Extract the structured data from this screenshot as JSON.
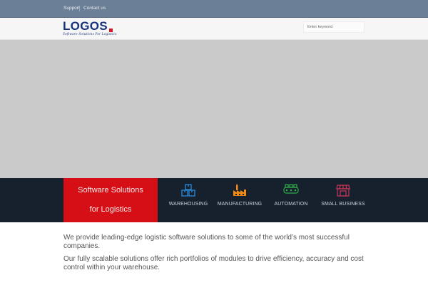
{
  "topbar": {
    "links": [
      "Support",
      "Contact us"
    ]
  },
  "header": {
    "logo": {
      "name": "LOGOS",
      "tagline": "Software Solutions For Logistics"
    },
    "search": {
      "placeholder": "Enter keyword"
    }
  },
  "hero": {
    "content": ""
  },
  "banner": {
    "title_line1": "Software Solutions",
    "title_line2": "for Logistics",
    "services": [
      {
        "label": "WAREHOUSING",
        "icon": "boxes-icon",
        "color": "#2a8ad8"
      },
      {
        "label": "MANUFACTURING",
        "icon": "factory-icon",
        "color": "#f08a12"
      },
      {
        "label": "AUTOMATION",
        "icon": "conveyor-icon",
        "color": "#2fae4a"
      },
      {
        "label": "SMALL BUSINESS",
        "icon": "storefront-icon",
        "color": "#c9375a"
      }
    ]
  },
  "intro": {
    "paragraph1": "We provide leading-edge logistic software solutions to some of the world’s most successful companies.",
    "paragraph2": "Our fully scalable solutions offer rich portfolios of modules to drive efficiency, accuracy and cost control within your warehouse."
  },
  "colors": {
    "topbar": "#6b7f96",
    "band": "#17212e",
    "accent": "#d50f15",
    "brand": "#17327a"
  }
}
